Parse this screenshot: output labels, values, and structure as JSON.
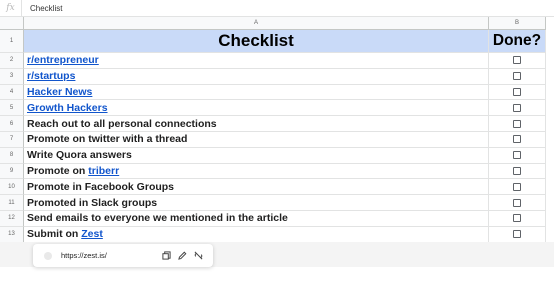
{
  "formula_bar": {
    "fx_label": "fx",
    "value": "Checklist"
  },
  "columns": {
    "a": "A",
    "b": "B"
  },
  "title_row": {
    "num": "1",
    "a": "Checklist",
    "b": "Done?"
  },
  "rows": [
    {
      "num": "2",
      "parts": [
        {
          "text": "r/entrepreneur",
          "link": true
        }
      ]
    },
    {
      "num": "3",
      "parts": [
        {
          "text": "r/startups",
          "link": true
        }
      ]
    },
    {
      "num": "4",
      "parts": [
        {
          "text": "Hacker News",
          "link": true
        }
      ]
    },
    {
      "num": "5",
      "parts": [
        {
          "text": "Growth Hackers",
          "link": true
        }
      ]
    },
    {
      "num": "6",
      "parts": [
        {
          "text": "Reach out to all personal connections",
          "link": false
        }
      ]
    },
    {
      "num": "7",
      "parts": [
        {
          "text": "Promote on twitter with a thread",
          "link": false
        }
      ]
    },
    {
      "num": "8",
      "parts": [
        {
          "text": "Write Quora answers",
          "link": false
        }
      ]
    },
    {
      "num": "9",
      "parts": [
        {
          "text": "Promote on ",
          "link": false
        },
        {
          "text": "triberr",
          "link": true
        }
      ]
    },
    {
      "num": "10",
      "parts": [
        {
          "text": "Promote in Facebook Groups",
          "link": false
        }
      ]
    },
    {
      "num": "11",
      "parts": [
        {
          "text": "Promoted in Slack groups",
          "link": false
        }
      ]
    },
    {
      "num": "12",
      "parts": [
        {
          "text": "Send emails to everyone we mentioned in the article",
          "link": false
        }
      ]
    },
    {
      "num": "13",
      "parts": [
        {
          "text": "Submit on ",
          "link": false
        },
        {
          "text": "Zest",
          "link": true
        }
      ]
    }
  ],
  "link_popup": {
    "url": "https://zest.is/",
    "icons": [
      "copy-icon",
      "edit-icon",
      "unlink-icon"
    ]
  },
  "colors": {
    "header_fill": "#c9daf8",
    "link": "#1155cc"
  }
}
